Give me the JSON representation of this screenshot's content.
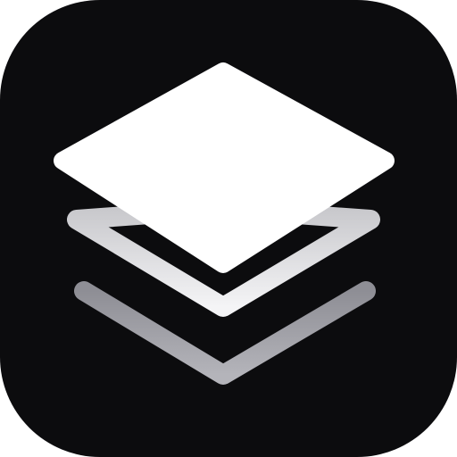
{
  "icon": {
    "name": "stacked-layers-icon",
    "background_color": "#0c0c0e",
    "layers": [
      {
        "name": "top-layer",
        "style": "filled",
        "color": "#ffffff"
      },
      {
        "name": "middle-layer",
        "style": "outline",
        "color": "#d9d9dd"
      },
      {
        "name": "bottom-layer",
        "style": "chevron",
        "color": "#a2a2a8"
      }
    ]
  }
}
